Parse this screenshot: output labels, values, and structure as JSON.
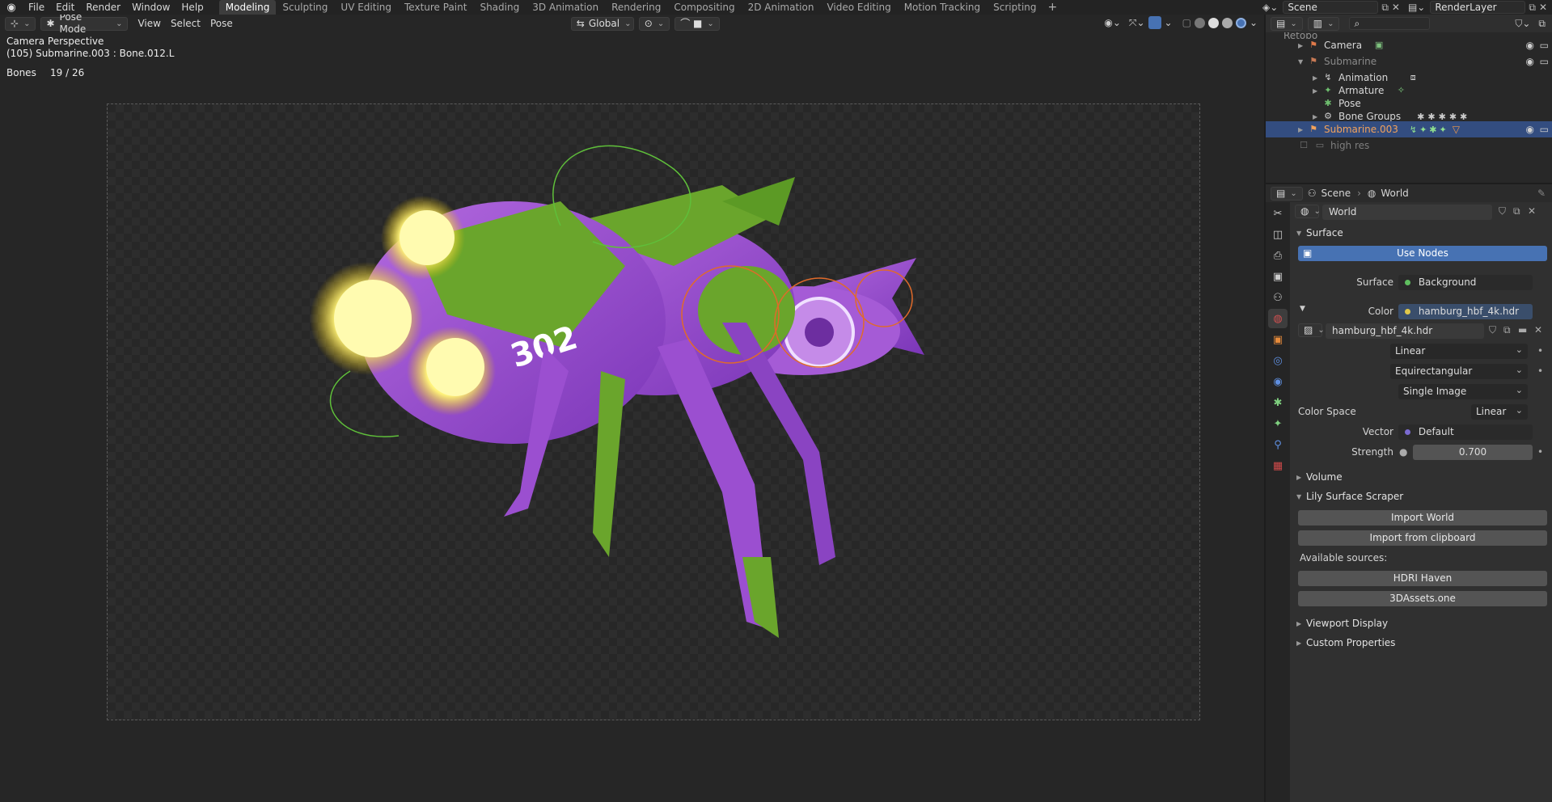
{
  "topbar": {
    "menu": [
      "File",
      "Edit",
      "Render",
      "Window",
      "Help"
    ],
    "workspaces": [
      "Modeling",
      "Sculpting",
      "UV Editing",
      "Texture Paint",
      "Shading",
      "3D Animation",
      "Rendering",
      "Compositing",
      "2D Animation",
      "Video Editing",
      "Motion Tracking",
      "Scripting"
    ],
    "active_workspace": "Modeling",
    "scene": "Scene",
    "view_layer": "RenderLayer"
  },
  "viewport": {
    "mode": "Pose Mode",
    "menus": [
      "View",
      "Select",
      "Pose"
    ],
    "orientation": "Global",
    "overlay_title": "Camera Perspective",
    "overlay_subtitle": "(105) Submarine.003 : Bone.012.L",
    "stats_label": "Bones",
    "stats_value": "19 / 26",
    "model_decal": "302"
  },
  "outliner": {
    "rows": [
      {
        "name": "Retopo",
        "dim": true,
        "indent": 1
      },
      {
        "name": "Camera",
        "dim": false,
        "indent": 1
      },
      {
        "name": "Submarine",
        "dim": true,
        "indent": 1
      },
      {
        "name": "Animation",
        "dim": false,
        "indent": 2
      },
      {
        "name": "Armature",
        "dim": false,
        "indent": 2
      },
      {
        "name": "Pose",
        "dim": false,
        "indent": 2
      },
      {
        "name": "Bone Groups",
        "dim": false,
        "indent": 2
      },
      {
        "name": "Submarine.003",
        "dim": false,
        "indent": 1,
        "selected": true
      },
      {
        "name": "high res",
        "dim": true,
        "indent": 1
      }
    ]
  },
  "properties": {
    "breadcrumb_scene": "Scene",
    "breadcrumb_world": "World",
    "world_name": "World",
    "surface_panel": "Surface",
    "use_nodes": "Use Nodes",
    "surface_label": "Surface",
    "surface_value": "Background",
    "color_label": "Color",
    "color_value": "hamburg_hbf_4k.hdr",
    "image_name": "hamburg_hbf_4k.hdr",
    "interp": "Linear",
    "projection": "Equirectangular",
    "source": "Single Image",
    "color_space_label": "Color Space",
    "color_space_value": "Linear",
    "vector_label": "Vector",
    "vector_value": "Default",
    "strength_label": "Strength",
    "strength_value": "0.700",
    "volume_panel": "Volume",
    "scraper_panel": "Lily Surface Scraper",
    "import_world": "Import World",
    "import_clipboard": "Import from clipboard",
    "available_sources": "Available sources:",
    "source_1": "HDRI Haven",
    "source_2": "3DAssets.one",
    "viewport_display_panel": "Viewport Display",
    "custom_props_panel": "Custom Properties"
  },
  "colors": {
    "accent": "#4772b3",
    "selected_row": "#334d80",
    "orange_text": "#f2a25c",
    "model_purple": "#9b4fd0",
    "model_green": "#6aa52c",
    "glow": "#fff37a"
  }
}
